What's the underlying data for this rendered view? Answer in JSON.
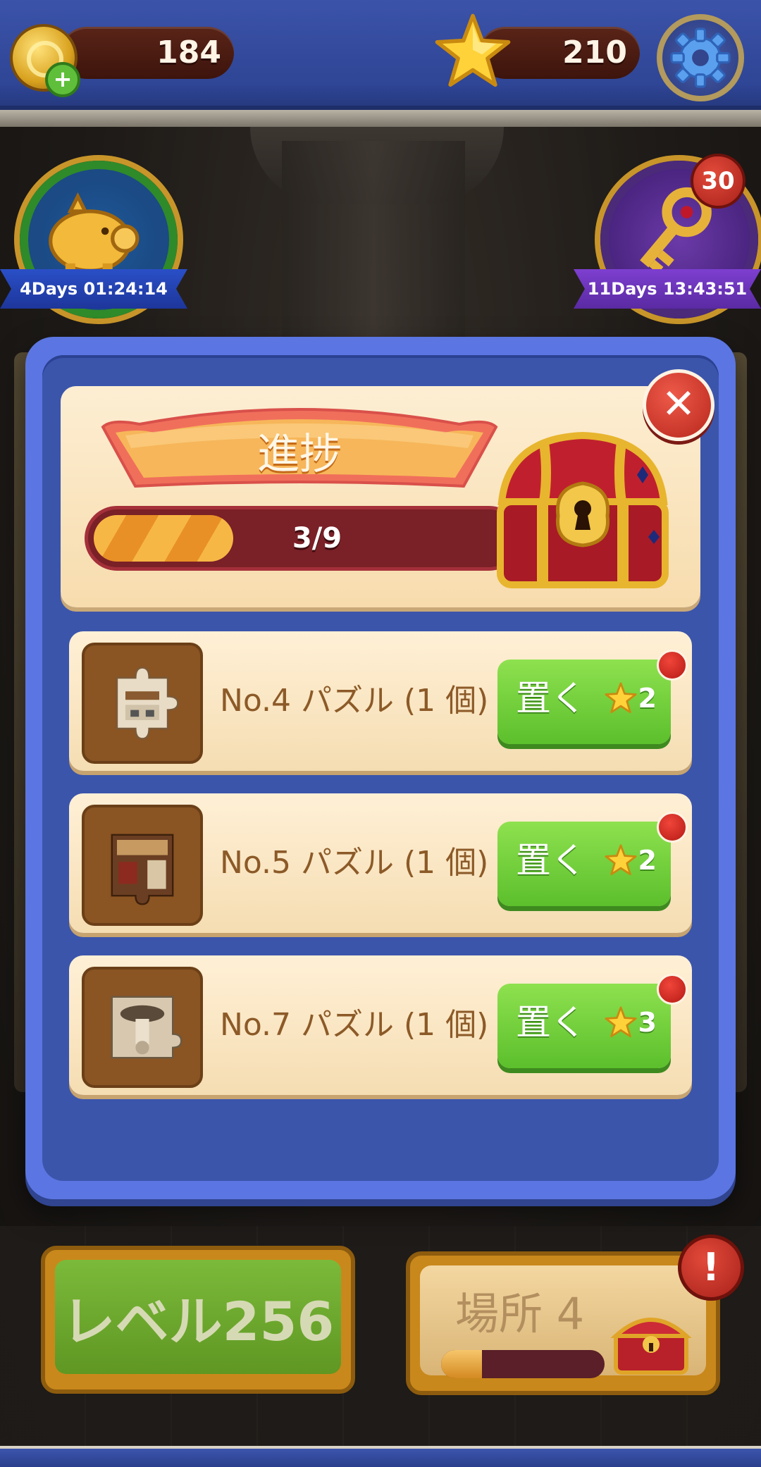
{
  "topbar": {
    "coins": "184",
    "stars": "210",
    "add_coins_glyph": "+",
    "settings_icon": "gear-icon"
  },
  "events": {
    "piggy_bank": {
      "timer": "4Days 01:24:14",
      "icon": "piggy-bank-icon"
    },
    "key_event": {
      "timer": "11Days 13:43:51",
      "count": "30",
      "icon": "key-icon"
    }
  },
  "modal": {
    "title": "進捗",
    "progress_text": "3/9",
    "progress": {
      "current": 3,
      "total": 9
    },
    "close_glyph": "✕",
    "reward_icon": "treasure-chest-icon",
    "items": [
      {
        "name": "No.4 パズル (1 個)",
        "button": "置く",
        "cost": "2"
      },
      {
        "name": "No.5 パズル (1 個)",
        "button": "置く",
        "cost": "2"
      },
      {
        "name": "No.7 パズル (1 個)",
        "button": "置く",
        "cost": "3"
      }
    ]
  },
  "bottom": {
    "level_label": "レベル256",
    "place_label": "場所 4",
    "place_progress": 0.25,
    "alert_glyph": "!"
  },
  "colors": {
    "modal_frame": "#5b76e2",
    "modal_body": "#3b55ab",
    "card": "#fdeed3",
    "green_button": "#6ccf38",
    "progress_fill": "#f7b744",
    "progress_track": "#7a2027"
  }
}
